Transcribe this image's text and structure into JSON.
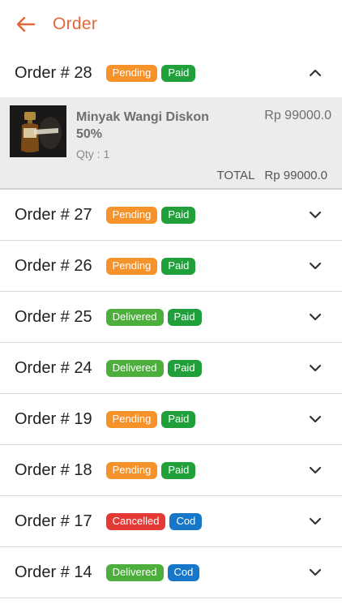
{
  "header": {
    "title": "Order"
  },
  "colors": {
    "accent": "#e2683a",
    "pending": "#f5922a",
    "paid": "#1fa03a",
    "delivered": "#4caf3c",
    "cancelled": "#e53935",
    "cod": "#1677c9"
  },
  "expanded": {
    "product_name": "Minyak Wangi Diskon 50%",
    "qty": "Qty : 1",
    "price": "Rp 99000.0",
    "total_label": "TOTAL",
    "total_value": "Rp 99000.0"
  },
  "orders": [
    {
      "title": "Order # 28",
      "status": "Pending",
      "payment": "Paid"
    },
    {
      "title": "Order # 27",
      "status": "Pending",
      "payment": "Paid"
    },
    {
      "title": "Order # 26",
      "status": "Pending",
      "payment": "Paid"
    },
    {
      "title": "Order # 25",
      "status": "Delivered",
      "payment": "Paid"
    },
    {
      "title": "Order # 24",
      "status": "Delivered",
      "payment": "Paid"
    },
    {
      "title": "Order # 19",
      "status": "Pending",
      "payment": "Paid"
    },
    {
      "title": "Order # 18",
      "status": "Pending",
      "payment": "Paid"
    },
    {
      "title": "Order # 17",
      "status": "Cancelled",
      "payment": "Cod"
    },
    {
      "title": "Order # 14",
      "status": "Delivered",
      "payment": "Cod"
    }
  ]
}
